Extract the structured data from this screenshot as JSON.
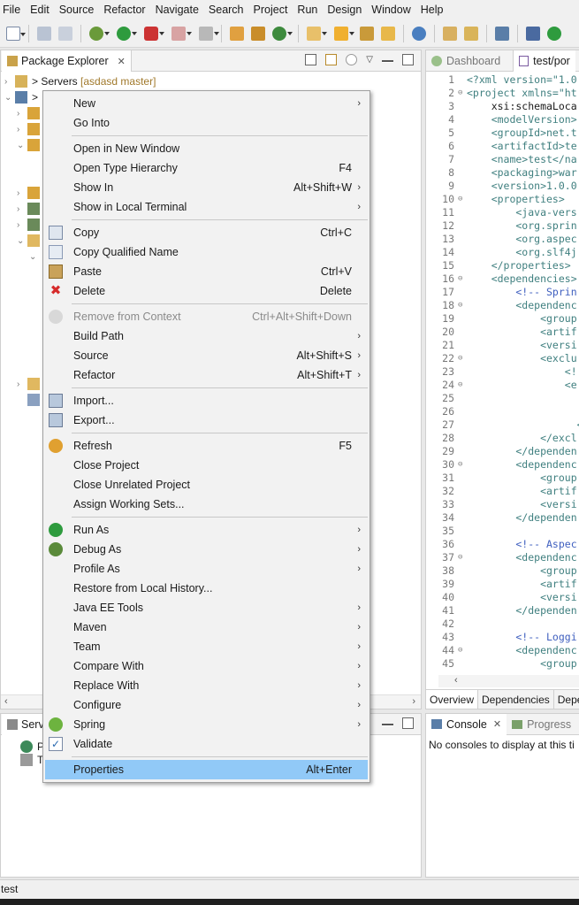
{
  "menubar": [
    "File",
    "Edit",
    "Source",
    "Refactor",
    "Navigate",
    "Search",
    "Project",
    "Run",
    "Design",
    "Window",
    "Help"
  ],
  "explorer": {
    "tab_label": "Package Explorer",
    "tree": {
      "servers_label": "> Servers",
      "servers_decoration": "[asdasd master]",
      "project_prefix": ">"
    }
  },
  "servers_panel": {
    "tab_label": "Serve",
    "items": [
      "P",
      "T"
    ]
  },
  "editor": {
    "tabs": [
      "Dashboard",
      "test/por"
    ],
    "lines": [
      {
        "n": "1",
        "fold": "",
        "text": "<?xml version=\"1.0"
      },
      {
        "n": "2",
        "fold": "⊖",
        "text": "<project xmlns=\"ht"
      },
      {
        "n": "3",
        "fold": "",
        "text": "    xsi:schemaLoca"
      },
      {
        "n": "4",
        "fold": "",
        "text": "    <modelVersion>"
      },
      {
        "n": "5",
        "fold": "",
        "text": "    <groupId>net.t"
      },
      {
        "n": "6",
        "fold": "",
        "text": "    <artifactId>te"
      },
      {
        "n": "7",
        "fold": "",
        "text": "    <name>test</na"
      },
      {
        "n": "8",
        "fold": "",
        "text": "    <packaging>war"
      },
      {
        "n": "9",
        "fold": "",
        "text": "    <version>1.0.0"
      },
      {
        "n": "10",
        "fold": "⊖",
        "text": "    <properties>"
      },
      {
        "n": "11",
        "fold": "",
        "text": "        <java-vers"
      },
      {
        "n": "12",
        "fold": "",
        "text": "        <org.sprin"
      },
      {
        "n": "13",
        "fold": "",
        "text": "        <org.aspec"
      },
      {
        "n": "14",
        "fold": "",
        "text": "        <org.slf4j"
      },
      {
        "n": "15",
        "fold": "",
        "text": "    </properties>"
      },
      {
        "n": "16",
        "fold": "⊖",
        "text": "    <dependencies>"
      },
      {
        "n": "17",
        "fold": "",
        "text": "        <!-- Sprin"
      },
      {
        "n": "18",
        "fold": "⊖",
        "text": "        <dependenc"
      },
      {
        "n": "19",
        "fold": "",
        "text": "            <group"
      },
      {
        "n": "20",
        "fold": "",
        "text": "            <artif"
      },
      {
        "n": "21",
        "fold": "",
        "text": "            <versi"
      },
      {
        "n": "22",
        "fold": "⊖",
        "text": "            <exclu"
      },
      {
        "n": "23",
        "fold": "",
        "text": "                <!"
      },
      {
        "n": "24",
        "fold": "⊖",
        "text": "                <e"
      },
      {
        "n": "25",
        "fold": "",
        "text": ""
      },
      {
        "n": "26",
        "fold": "",
        "text": ""
      },
      {
        "n": "27",
        "fold": "",
        "text": "                  <"
      },
      {
        "n": "28",
        "fold": "",
        "text": "            </excl"
      },
      {
        "n": "29",
        "fold": "",
        "text": "        </dependen"
      },
      {
        "n": "30",
        "fold": "⊖",
        "text": "        <dependenc"
      },
      {
        "n": "31",
        "fold": "",
        "text": "            <group"
      },
      {
        "n": "32",
        "fold": "",
        "text": "            <artif"
      },
      {
        "n": "33",
        "fold": "",
        "text": "            <versi"
      },
      {
        "n": "34",
        "fold": "",
        "text": "        </dependen"
      },
      {
        "n": "35",
        "fold": "",
        "text": ""
      },
      {
        "n": "36",
        "fold": "",
        "text": "        <!-- Aspec"
      },
      {
        "n": "37",
        "fold": "⊖",
        "text": "        <dependenc"
      },
      {
        "n": "38",
        "fold": "",
        "text": "            <group"
      },
      {
        "n": "39",
        "fold": "",
        "text": "            <artif"
      },
      {
        "n": "40",
        "fold": "",
        "text": "            <versi"
      },
      {
        "n": "41",
        "fold": "",
        "text": "        </dependen"
      },
      {
        "n": "42",
        "fold": "",
        "text": ""
      },
      {
        "n": "43",
        "fold": "",
        "text": "        <!-- Loggi"
      },
      {
        "n": "44",
        "fold": "⊖",
        "text": "        <dependenc"
      },
      {
        "n": "45",
        "fold": "",
        "text": "            <group"
      }
    ],
    "bottom_tabs": [
      "Overview",
      "Dependencies",
      "Depe"
    ]
  },
  "console": {
    "tabs": [
      "Console",
      "Progress"
    ],
    "message": "No consoles to display at this ti"
  },
  "status_bar": {
    "text": "test"
  },
  "context_menu": {
    "groups": [
      [
        {
          "label": "New",
          "shortcut": "",
          "submenu": true,
          "icon": "",
          "disabled": false
        },
        {
          "label": "Go Into",
          "shortcut": "",
          "submenu": false,
          "icon": "",
          "disabled": false
        }
      ],
      [
        {
          "label": "Open in New Window",
          "shortcut": "",
          "submenu": false,
          "icon": "",
          "disabled": false
        },
        {
          "label": "Open Type Hierarchy",
          "shortcut": "F4",
          "submenu": false,
          "icon": "",
          "disabled": false
        },
        {
          "label": "Show In",
          "shortcut": "Alt+Shift+W",
          "submenu": true,
          "icon": "",
          "disabled": false
        },
        {
          "label": "Show in Local Terminal",
          "shortcut": "",
          "submenu": true,
          "icon": "",
          "disabled": false
        }
      ],
      [
        {
          "label": "Copy",
          "shortcut": "Ctrl+C",
          "submenu": false,
          "icon": "copy-icon",
          "disabled": false
        },
        {
          "label": "Copy Qualified Name",
          "shortcut": "",
          "submenu": false,
          "icon": "copy-qualified-icon",
          "disabled": false
        },
        {
          "label": "Paste",
          "shortcut": "Ctrl+V",
          "submenu": false,
          "icon": "paste-icon",
          "disabled": false
        },
        {
          "label": "Delete",
          "shortcut": "Delete",
          "submenu": false,
          "icon": "delete-icon",
          "disabled": false
        }
      ],
      [
        {
          "label": "Remove from Context",
          "shortcut": "Ctrl+Alt+Shift+Down",
          "submenu": false,
          "icon": "remove-context-icon",
          "disabled": true
        },
        {
          "label": "Build Path",
          "shortcut": "",
          "submenu": true,
          "icon": "",
          "disabled": false
        },
        {
          "label": "Source",
          "shortcut": "Alt+Shift+S",
          "submenu": true,
          "icon": "",
          "disabled": false
        },
        {
          "label": "Refactor",
          "shortcut": "Alt+Shift+T",
          "submenu": true,
          "icon": "",
          "disabled": false
        }
      ],
      [
        {
          "label": "Import...",
          "shortcut": "",
          "submenu": false,
          "icon": "import-icon",
          "disabled": false
        },
        {
          "label": "Export...",
          "shortcut": "",
          "submenu": false,
          "icon": "export-icon",
          "disabled": false
        }
      ],
      [
        {
          "label": "Refresh",
          "shortcut": "F5",
          "submenu": false,
          "icon": "refresh-icon",
          "disabled": false
        },
        {
          "label": "Close Project",
          "shortcut": "",
          "submenu": false,
          "icon": "",
          "disabled": false
        },
        {
          "label": "Close Unrelated Project",
          "shortcut": "",
          "submenu": false,
          "icon": "",
          "disabled": false
        },
        {
          "label": "Assign Working Sets...",
          "shortcut": "",
          "submenu": false,
          "icon": "",
          "disabled": false
        }
      ],
      [
        {
          "label": "Run As",
          "shortcut": "",
          "submenu": true,
          "icon": "run-icon",
          "disabled": false
        },
        {
          "label": "Debug As",
          "shortcut": "",
          "submenu": true,
          "icon": "debug-icon",
          "disabled": false
        },
        {
          "label": "Profile As",
          "shortcut": "",
          "submenu": true,
          "icon": "",
          "disabled": false
        },
        {
          "label": "Restore from Local History...",
          "shortcut": "",
          "submenu": false,
          "icon": "",
          "disabled": false
        },
        {
          "label": "Java EE Tools",
          "shortcut": "",
          "submenu": true,
          "icon": "",
          "disabled": false
        },
        {
          "label": "Maven",
          "shortcut": "",
          "submenu": true,
          "icon": "",
          "disabled": false
        },
        {
          "label": "Team",
          "shortcut": "",
          "submenu": true,
          "icon": "",
          "disabled": false
        },
        {
          "label": "Compare With",
          "shortcut": "",
          "submenu": true,
          "icon": "",
          "disabled": false
        },
        {
          "label": "Replace With",
          "shortcut": "",
          "submenu": true,
          "icon": "",
          "disabled": false
        },
        {
          "label": "Configure",
          "shortcut": "",
          "submenu": true,
          "icon": "",
          "disabled": false
        },
        {
          "label": "Spring",
          "shortcut": "",
          "submenu": true,
          "icon": "spring-icon",
          "disabled": false
        },
        {
          "label": "Validate",
          "shortcut": "",
          "submenu": false,
          "icon": "validate-check-icon",
          "disabled": false
        }
      ],
      [
        {
          "label": "Properties",
          "shortcut": "Alt+Enter",
          "submenu": false,
          "icon": "",
          "disabled": false,
          "selected": true
        }
      ]
    ]
  },
  "colors": {
    "selection": "#91c9f7",
    "delete_red": "#d62b2b",
    "run_green": "#2e9b3e",
    "spring_green": "#6db33f",
    "xml_tag": "#3f7f7f",
    "xml_comment": "#3f5fbf"
  }
}
